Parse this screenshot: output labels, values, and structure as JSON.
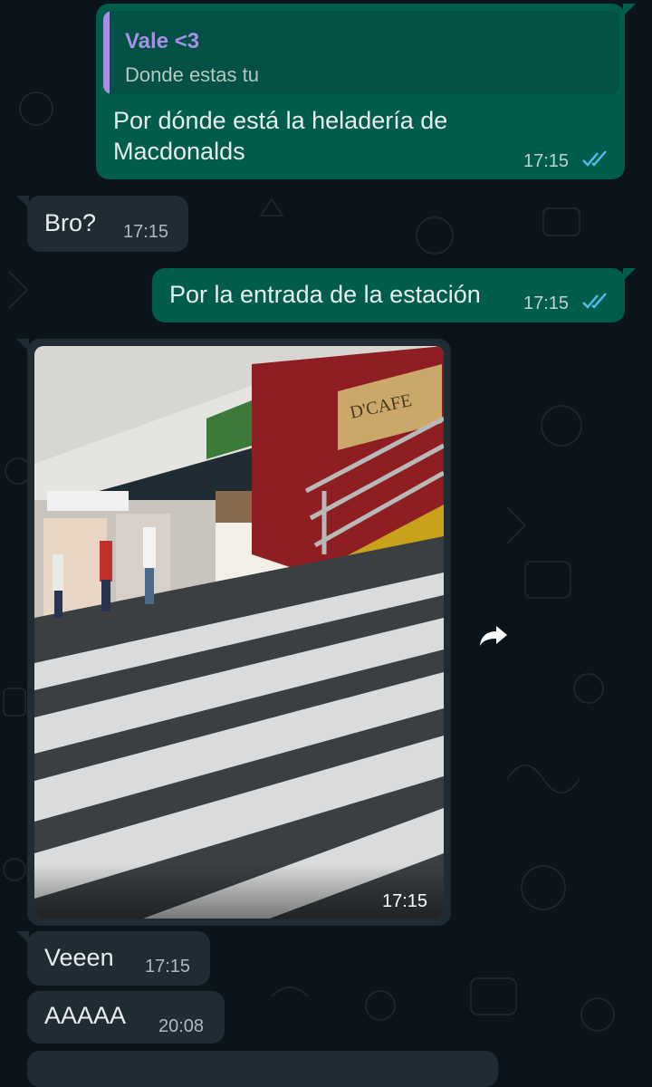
{
  "messages": {
    "m1": {
      "quote_author": "Vale <3",
      "quote_text": "Donde estas tu",
      "text_line1": "Por dónde está la heladería de",
      "text_line2": "Macdonalds",
      "time": "17:15",
      "status": "read"
    },
    "m2": {
      "text": "Bro?",
      "time": "17:15"
    },
    "m3": {
      "text": "Por la entrada de la estación",
      "time": "17:15",
      "status": "read"
    },
    "m4": {
      "media": "photo",
      "sign_text": "D'CAFE",
      "time": "17:15"
    },
    "m5": {
      "text": "Veeen",
      "time": "17:15"
    },
    "m6": {
      "text": "AAAAA",
      "time": "20:08"
    }
  },
  "icons": {
    "read_receipt": "double-check-icon",
    "forward": "forward-icon"
  },
  "colors": {
    "background": "#0b141a",
    "outgoing_bubble": "#005c4b",
    "incoming_bubble": "#202c33",
    "read_tick": "#53bdeb",
    "quote_accent": "#a791e6"
  }
}
